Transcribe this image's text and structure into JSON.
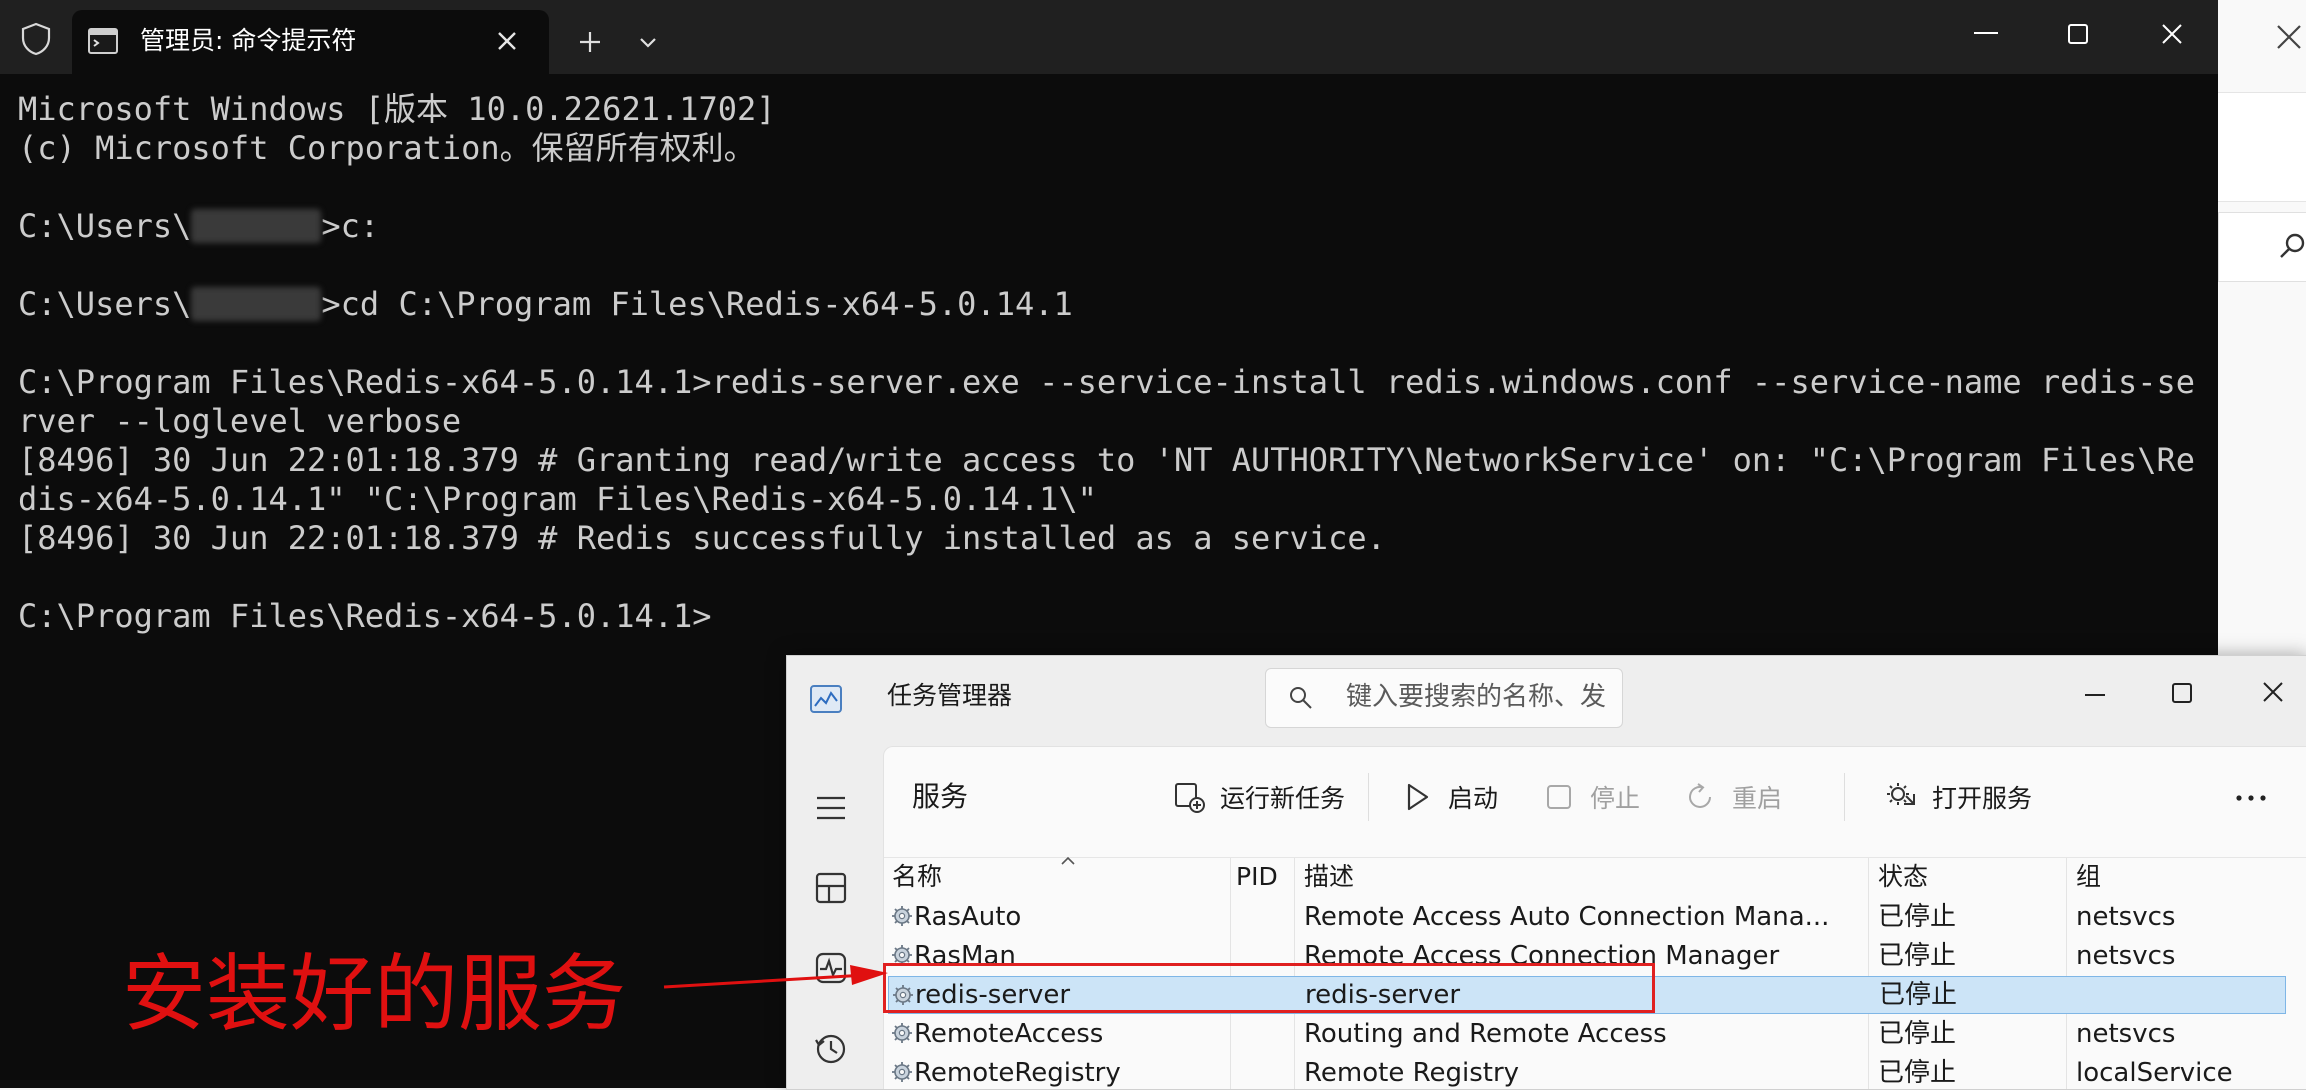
{
  "terminal": {
    "tab_title": "管理员: 命令提示符",
    "lines": [
      "Microsoft Windows [版本 10.0.22621.1702]",
      "(c) Microsoft Corporation。保留所有权利。",
      "",
      "C:\\Users\\",
      "",
      "C:\\Users\\",
      "",
      "C:\\Program Files\\Redis-x64-5.0.14.1>redis-server.exe --service-install redis.windows.conf --service-name redis-se",
      "rver --loglevel verbose",
      "[8496] 30 Jun 22:01:18.379 # Granting read/write access to 'NT AUTHORITY\\NetworkService' on: \"C:\\Program Files\\Re",
      "dis-x64-5.0.14.1\" \"C:\\Program Files\\Redis-x64-5.0.14.1\\\"",
      "[8496] 30 Jun 22:01:18.379 # Redis successfully installed as a service.",
      "",
      "C:\\Program Files\\Redis-x64-5.0.14.1>"
    ],
    "line3_suffix": ">c:",
    "line5_suffix": ">cd C:\\Program Files\\Redis-x64-5.0.14.1",
    "icons": {
      "shield": "shield-icon",
      "tab": "cmd-icon",
      "close": "close-icon",
      "new_tab": "plus-icon",
      "dropdown": "chevron-down-icon"
    }
  },
  "taskmgr": {
    "title": "任务管理器",
    "search_placeholder": "键入要搜索的名称、发布者或 PID",
    "page_title": "服务",
    "toolbar": {
      "run_new_task": "运行新任务",
      "start": "启动",
      "stop": "停止",
      "restart": "重启",
      "open_services": "打开服务"
    },
    "columns": {
      "name": "名称",
      "pid": "PID",
      "desc": "描述",
      "status": "状态",
      "group": "组"
    },
    "rows": [
      {
        "name": "RasAuto",
        "pid": "",
        "desc": "Remote Access Auto Connection Mana...",
        "status": "已停止",
        "group": "netsvcs"
      },
      {
        "name": "RasMan",
        "pid": "",
        "desc": "Remote Access Connection Manager",
        "status": "已停止",
        "group": "netsvcs"
      },
      {
        "name": "redis-server",
        "pid": "",
        "desc": "redis-server",
        "status": "已停止",
        "group": ""
      },
      {
        "name": "RemoteAccess",
        "pid": "",
        "desc": "Routing and Remote Access",
        "status": "已停止",
        "group": "netsvcs"
      },
      {
        "name": "RemoteRegistry",
        "pid": "",
        "desc": "Remote Registry",
        "status": "已停止",
        "group": "localService"
      }
    ],
    "selected_row": 2
  },
  "annotation": {
    "text": "安装好的服务",
    "color": "#e01010"
  },
  "colors": {
    "terminal_bg": "#0c0c0c",
    "terminal_text": "#cccccc",
    "tabbar_bg": "#202020",
    "selection": "#cce4f7",
    "highlight": "#e02020"
  }
}
